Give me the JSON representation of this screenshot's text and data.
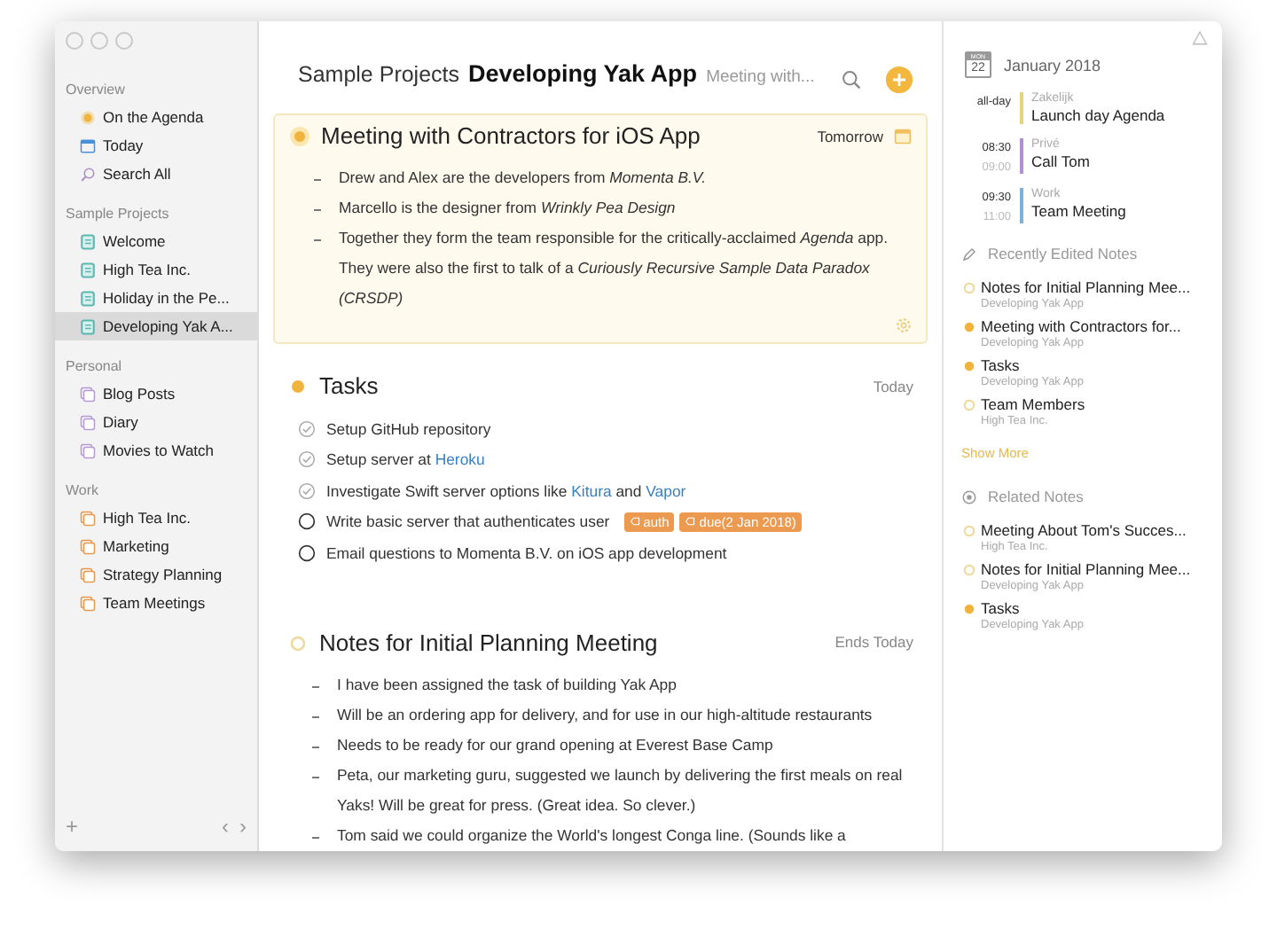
{
  "sidebar": {
    "sections": [
      {
        "title": "Overview",
        "items": [
          {
            "label": "On the Agenda",
            "kind": "agenda",
            "color": "#f0b43c",
            "selected": false
          },
          {
            "label": "Today",
            "kind": "calendar",
            "color": "#4a90d9",
            "selected": false
          },
          {
            "label": "Search All",
            "kind": "search",
            "color": "#a98fc4",
            "selected": false
          }
        ]
      },
      {
        "title": "Sample Projects",
        "items": [
          {
            "label": "Welcome",
            "kind": "note",
            "color": "#5bb8b0",
            "selected": false
          },
          {
            "label": "High Tea Inc.",
            "kind": "note",
            "color": "#5bb8b0",
            "selected": false
          },
          {
            "label": "Holiday in the Pe...",
            "kind": "note",
            "color": "#5bb8b0",
            "selected": false
          },
          {
            "label": "Developing Yak A...",
            "kind": "note",
            "color": "#5bb8b0",
            "selected": true
          }
        ]
      },
      {
        "title": "Personal",
        "items": [
          {
            "label": "Blog Posts",
            "kind": "folder",
            "color": "#b59ad6",
            "selected": false
          },
          {
            "label": "Diary",
            "kind": "folder",
            "color": "#b59ad6",
            "selected": false
          },
          {
            "label": "Movies to Watch",
            "kind": "folder",
            "color": "#b59ad6",
            "selected": false
          }
        ]
      },
      {
        "title": "Work",
        "items": [
          {
            "label": "High Tea Inc.",
            "kind": "folder",
            "color": "#e8984a",
            "selected": false
          },
          {
            "label": "Marketing",
            "kind": "folder",
            "color": "#e8984a",
            "selected": false
          },
          {
            "label": "Strategy Planning",
            "kind": "folder",
            "color": "#e8984a",
            "selected": false
          },
          {
            "label": "Team Meetings",
            "kind": "folder",
            "color": "#e8984a",
            "selected": false
          }
        ]
      }
    ],
    "footer": {
      "add": "+",
      "back": "‹",
      "forward": "›"
    }
  },
  "header": {
    "category": "Sample Projects",
    "project": "Developing Yak App",
    "note": "Meeting with..."
  },
  "notes": [
    {
      "title": "Meeting with Contractors for iOS App",
      "kind": "agenda",
      "date": "Tomorrow",
      "highlighted": true,
      "items": [
        "Drew and Alex are the developers from *Momenta B.V.*",
        "Marcello is the designer from *Wrinkly Pea Design*",
        "Together they form the team responsible for the critically-acclaimed *Agenda* app. They were also the first to talk of a *Curiously Recursive Sample Data Paradox (CRSDP)*"
      ]
    },
    {
      "title": "Tasks",
      "kind": "filled",
      "date": "Today",
      "highlighted": false,
      "tasks": [
        {
          "checked": true,
          "parts": [
            {
              "kind": "text",
              "text": "Setup GitHub repository"
            }
          ]
        },
        {
          "checked": true,
          "parts": [
            {
              "kind": "text",
              "text": "Setup server at "
            },
            {
              "kind": "link",
              "text": "Heroku"
            }
          ]
        },
        {
          "checked": true,
          "parts": [
            {
              "kind": "text",
              "text": "Investigate Swift server options like "
            },
            {
              "kind": "link",
              "text": "Kitura"
            },
            {
              "kind": "text",
              "text": " and "
            },
            {
              "kind": "link",
              "text": "Vapor"
            }
          ]
        },
        {
          "checked": false,
          "parts": [
            {
              "kind": "text",
              "text": "Write basic server that authenticates user"
            },
            {
              "kind": "tag",
              "text": "auth"
            },
            {
              "kind": "tag",
              "text": "due(2 Jan 2018)"
            }
          ]
        },
        {
          "checked": false,
          "parts": [
            {
              "kind": "text",
              "text": "Email questions to Momenta B.V. on iOS app development"
            }
          ]
        }
      ]
    },
    {
      "title": "Notes for Initial Planning Meeting",
      "kind": "hollow",
      "date": "Ends Today",
      "highlighted": false,
      "items": [
        "I have been assigned the task of building Yak App",
        "Will be an ordering app for delivery, and for use in our high-altitude restaurants",
        "Needs to be ready for our grand opening at Everest Base Camp",
        "Peta, our marketing guru, suggested we launch by delivering the first meals on real Yaks! Will be great for press. (Great idea. So clever.)",
        "Tom said we could organize the World's longest Conga line. (Sounds like a"
      ]
    }
  ],
  "calendar": {
    "month": "January 2018",
    "icon_month": "MON",
    "icon_day": "22",
    "events": [
      {
        "start": "all-day",
        "calendar": "Zakelijk",
        "title": "Launch day Agenda",
        "color": "#e8d27a"
      },
      {
        "start": "08:30",
        "end": "09:00",
        "calendar": "Privé",
        "title": "Call Tom",
        "color": "#b28fd0"
      },
      {
        "start": "09:30",
        "end": "11:00",
        "calendar": "Work",
        "title": "Team Meeting",
        "color": "#7fb0dc"
      }
    ]
  },
  "recent": {
    "title": "Recently Edited Notes",
    "items": [
      {
        "title": "Notes for Initial Planning Mee...",
        "project": "Developing Yak App",
        "kind": "hollow"
      },
      {
        "title": "Meeting with Contractors for...",
        "project": "Developing Yak App",
        "kind": "filled"
      },
      {
        "title": "Tasks",
        "project": "Developing Yak App",
        "kind": "filled"
      },
      {
        "title": "Team Members",
        "project": "High Tea Inc.",
        "kind": "hollow"
      }
    ],
    "more": "Show More"
  },
  "related": {
    "title": "Related Notes",
    "items": [
      {
        "title": "Meeting About Tom's Succes...",
        "project": "High Tea Inc.",
        "kind": "hollow"
      },
      {
        "title": "Notes for Initial Planning Mee...",
        "project": "Developing Yak App",
        "kind": "hollow"
      },
      {
        "title": "Tasks",
        "project": "Developing Yak App",
        "kind": "filled"
      }
    ]
  }
}
